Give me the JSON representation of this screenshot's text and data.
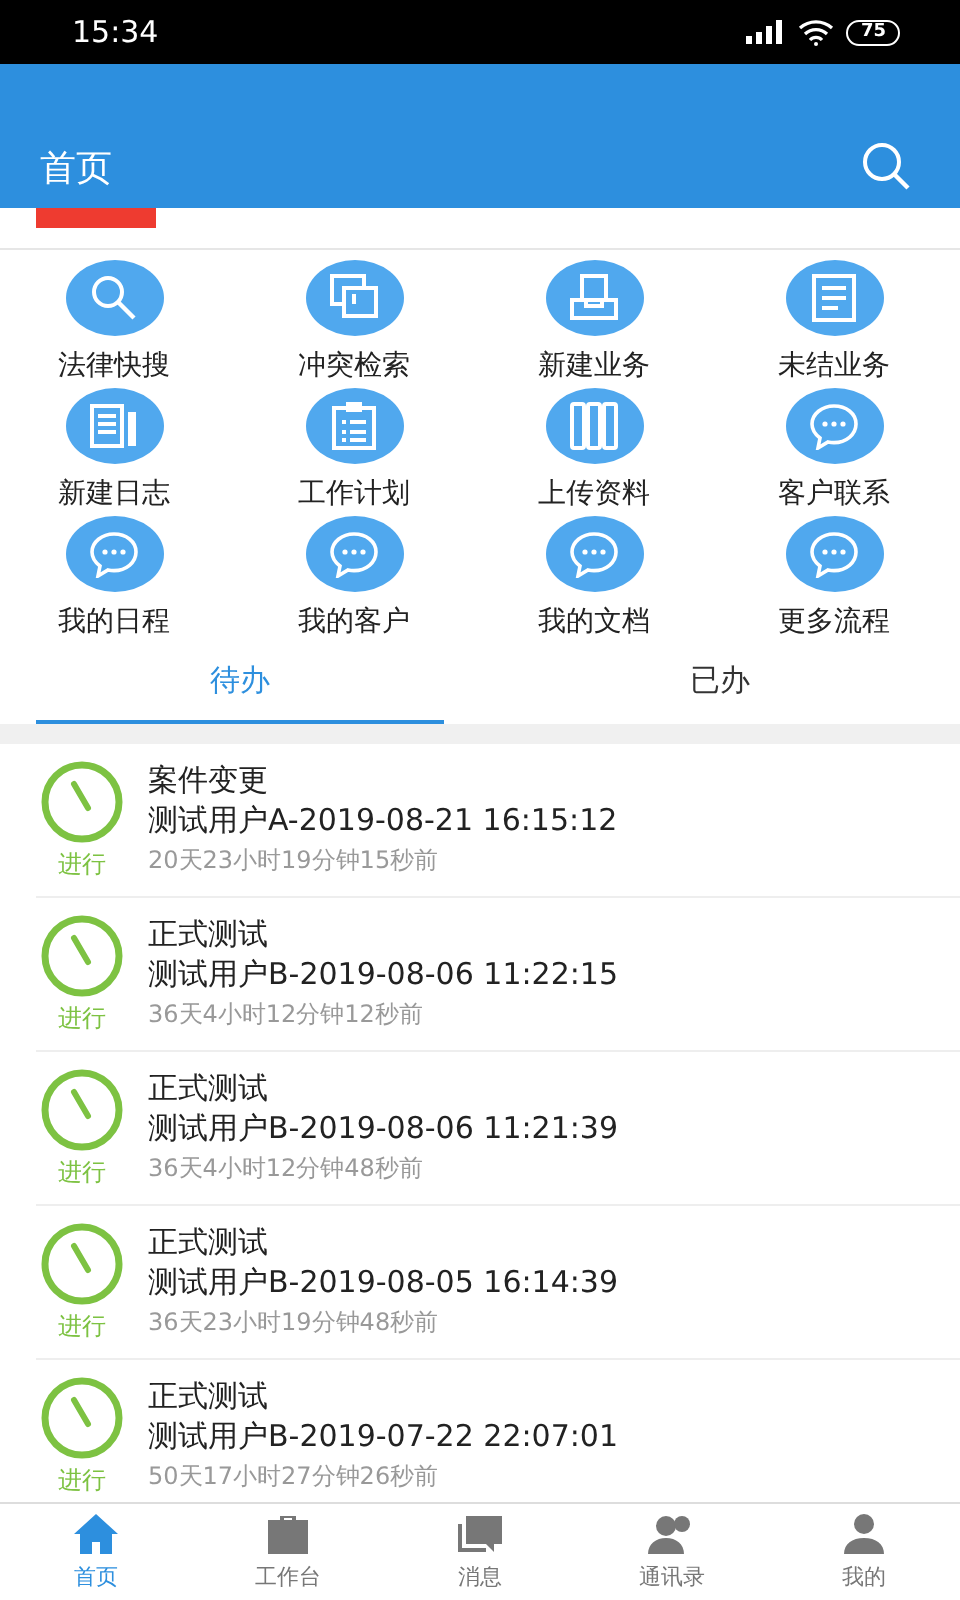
{
  "status_bar": {
    "time": "15:34",
    "battery": "75"
  },
  "header": {
    "title": "首页"
  },
  "shortcuts": [
    {
      "label": "法律快搜",
      "kind": "search"
    },
    {
      "label": "冲突检索",
      "kind": "conflict"
    },
    {
      "label": "新建业务",
      "kind": "tray"
    },
    {
      "label": "未结业务",
      "kind": "doc"
    },
    {
      "label": "新建日志",
      "kind": "notes"
    },
    {
      "label": "工作计划",
      "kind": "clipboard"
    },
    {
      "label": "上传资料",
      "kind": "binders"
    },
    {
      "label": "客户联系",
      "kind": "chat"
    },
    {
      "label": "我的日程",
      "kind": "chat"
    },
    {
      "label": "我的客户",
      "kind": "chat"
    },
    {
      "label": "我的文档",
      "kind": "chat"
    },
    {
      "label": "更多流程",
      "kind": "chat"
    }
  ],
  "tabs": [
    {
      "label": "待办",
      "selected": true
    },
    {
      "label": "已办",
      "selected": false
    }
  ],
  "tasks": [
    {
      "status": "进行",
      "title": "案件变更",
      "subtitle": "测试用户A-2019-08-21 16:15:12",
      "elapsed": "20天23小时19分钟15秒前"
    },
    {
      "status": "进行",
      "title": "正式测试",
      "subtitle": "测试用户B-2019-08-06 11:22:15",
      "elapsed": "36天4小时12分钟12秒前"
    },
    {
      "status": "进行",
      "title": "正式测试",
      "subtitle": "测试用户B-2019-08-06 11:21:39",
      "elapsed": "36天4小时12分钟48秒前"
    },
    {
      "status": "进行",
      "title": "正式测试",
      "subtitle": "测试用户B-2019-08-05 16:14:39",
      "elapsed": "36天23小时19分钟48秒前"
    },
    {
      "status": "进行",
      "title": "正式测试",
      "subtitle": "测试用户B-2019-07-22 22:07:01",
      "elapsed": "50天17小时27分钟26秒前"
    }
  ],
  "bottom_nav": [
    {
      "label": "首页",
      "kind": "home",
      "selected": true
    },
    {
      "label": "工作台",
      "kind": "briefcase",
      "selected": false
    },
    {
      "label": "消息",
      "kind": "message",
      "selected": false
    },
    {
      "label": "通讯录",
      "kind": "contacts",
      "selected": false
    },
    {
      "label": "我的",
      "kind": "person",
      "selected": false
    }
  ]
}
